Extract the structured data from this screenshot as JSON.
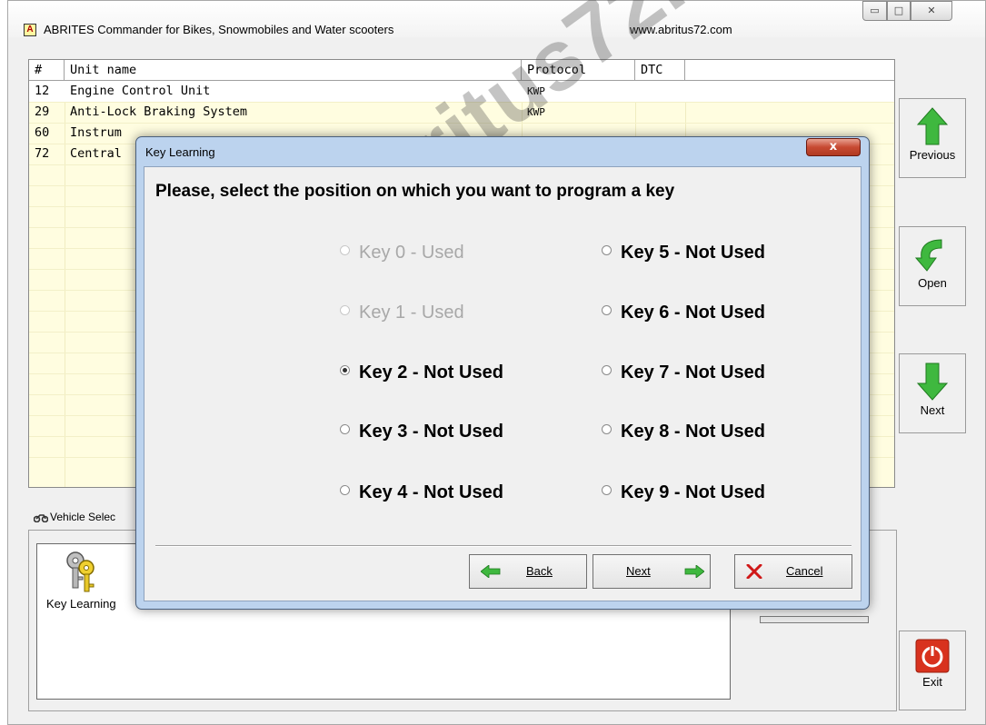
{
  "window": {
    "title": "ABRITES Commander for Bikes, Snowmobiles and Water scooters",
    "url": "www.abritus72.com",
    "app_icon_letter": "A",
    "minimize_glyph": "▭",
    "maximize_glyph": "□",
    "close_glyph": "✕"
  },
  "table": {
    "headers": [
      "#",
      "Unit name",
      "Protocol",
      "DTC"
    ],
    "rows": [
      {
        "num": "12",
        "name": "Engine Control Unit",
        "protocol": "KWP"
      },
      {
        "num": "29",
        "name": "Anti-Lock Braking System",
        "protocol": "KWP"
      },
      {
        "num": "60",
        "name": "Instrum",
        "protocol": ""
      },
      {
        "num": "72",
        "name": "Central",
        "protocol": ""
      }
    ]
  },
  "sidebar": {
    "previous": "Previous",
    "open": "Open",
    "next": "Next",
    "exit": "Exit"
  },
  "vehicle_panel": {
    "tab_label": "Vehicle Selec",
    "item_label": "Key Learning"
  },
  "dialog": {
    "title": "Key Learning",
    "close_glyph": "x",
    "heading": "Please, select the position on which you want to program a key",
    "keys": [
      {
        "label": "Key 0 - Used",
        "enabled": false,
        "selected": false
      },
      {
        "label": "Key 1 - Used",
        "enabled": false,
        "selected": false
      },
      {
        "label": "Key 2 - Not Used",
        "enabled": true,
        "selected": true
      },
      {
        "label": "Key 3 - Not Used",
        "enabled": true,
        "selected": false
      },
      {
        "label": "Key 4 - Not Used",
        "enabled": true,
        "selected": false
      },
      {
        "label": "Key 5 - Not Used",
        "enabled": true,
        "selected": false
      },
      {
        "label": "Key 6 - Not Used",
        "enabled": true,
        "selected": false
      },
      {
        "label": "Key 7 - Not Used",
        "enabled": true,
        "selected": false
      },
      {
        "label": "Key 8 - Not Used",
        "enabled": true,
        "selected": false
      },
      {
        "label": "Key 9 - Not Used",
        "enabled": true,
        "selected": false
      }
    ],
    "buttons": {
      "back": "Back",
      "next": "Next",
      "cancel": "Cancel"
    }
  },
  "watermark": "www.abritus72.com",
  "colors": {
    "table_bg": "#fffde0",
    "dialog_frame": "#bcd3ee",
    "arrow_green": "#3fb83f",
    "exit_red": "#d8321e",
    "cancel_red": "#d01818"
  },
  "icons": {
    "previous": "green-up-arrow-icon",
    "open": "green-curved-arrow-icon",
    "next": "green-down-arrow-icon",
    "exit": "red-power-icon",
    "tab": "motorbike-icon",
    "key_learning": "keys-icon",
    "back": "green-left-arrow-icon",
    "dialog_next": "green-right-arrow-icon",
    "cancel": "red-x-icon"
  }
}
